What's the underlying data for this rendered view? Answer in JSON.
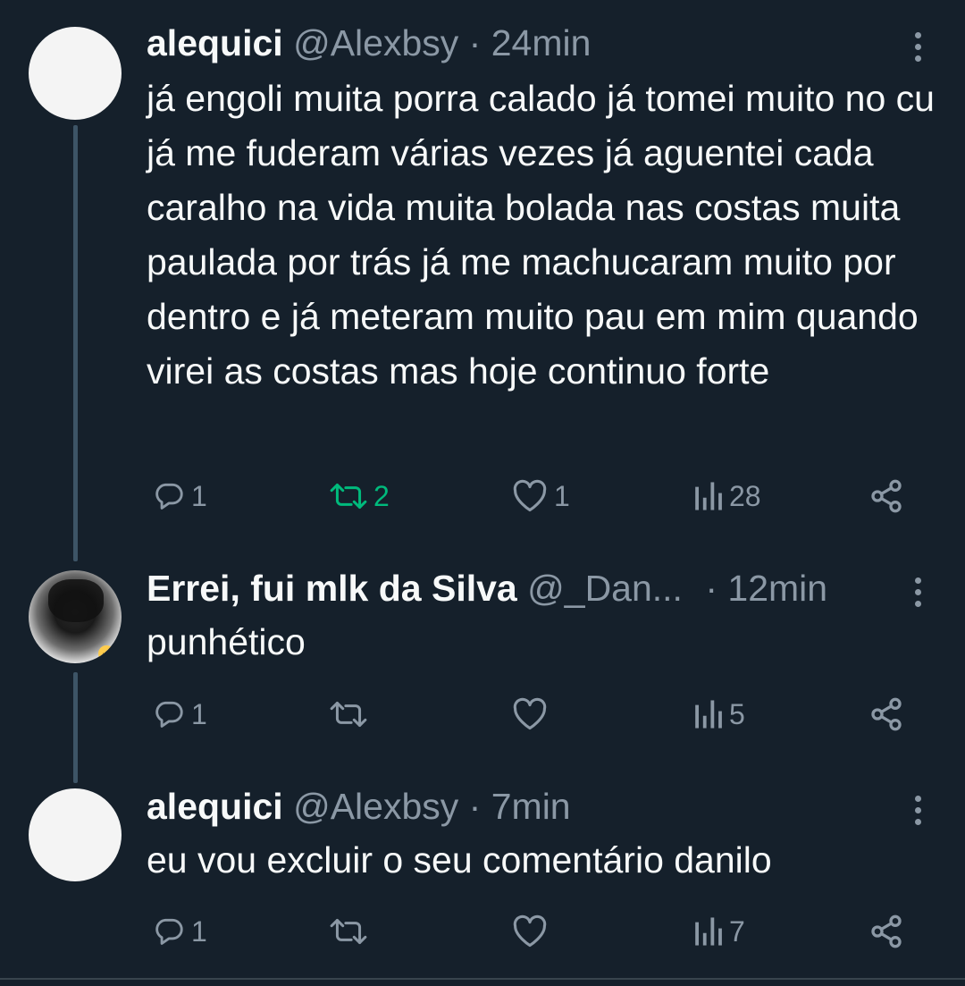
{
  "tweets": [
    {
      "name": "alequici",
      "handle": "@Alexbsy",
      "dot": "·",
      "time": "24min",
      "text": "já engoli muita porra calado já tomei muito no cu já me fuderam várias vezes já aguentei cada caralho na vida muita bolada nas costas muita paulada por trás já me machucaram muito por dentro e já meteram muito pau em mim quando virei as costas mas hoje continuo forte",
      "replies": "1",
      "retweets": "2",
      "likes": "1",
      "views": "28"
    },
    {
      "name": "Errei, fui mlk da Silva",
      "handle": "@_Dan...",
      "dot": "·",
      "time": "12min",
      "text": "punhético",
      "replies": "1",
      "retweets": "",
      "likes": "",
      "views": "5"
    },
    {
      "name": "alequici",
      "handle": "@Alexbsy",
      "dot": "·",
      "time": "7min",
      "text": "eu vou excluir o seu comentário danilo",
      "replies": "1",
      "retweets": "",
      "likes": "",
      "views": "7"
    }
  ],
  "colors": {
    "background": "#15202b",
    "text": "#f7f9f9",
    "secondary": "#8b98a5",
    "retweet_active": "#00ba7c",
    "thread_line": "#3d5466"
  },
  "icons": [
    "reply-icon",
    "retweet-icon",
    "like-icon",
    "views-icon",
    "share-icon",
    "more-icon"
  ]
}
